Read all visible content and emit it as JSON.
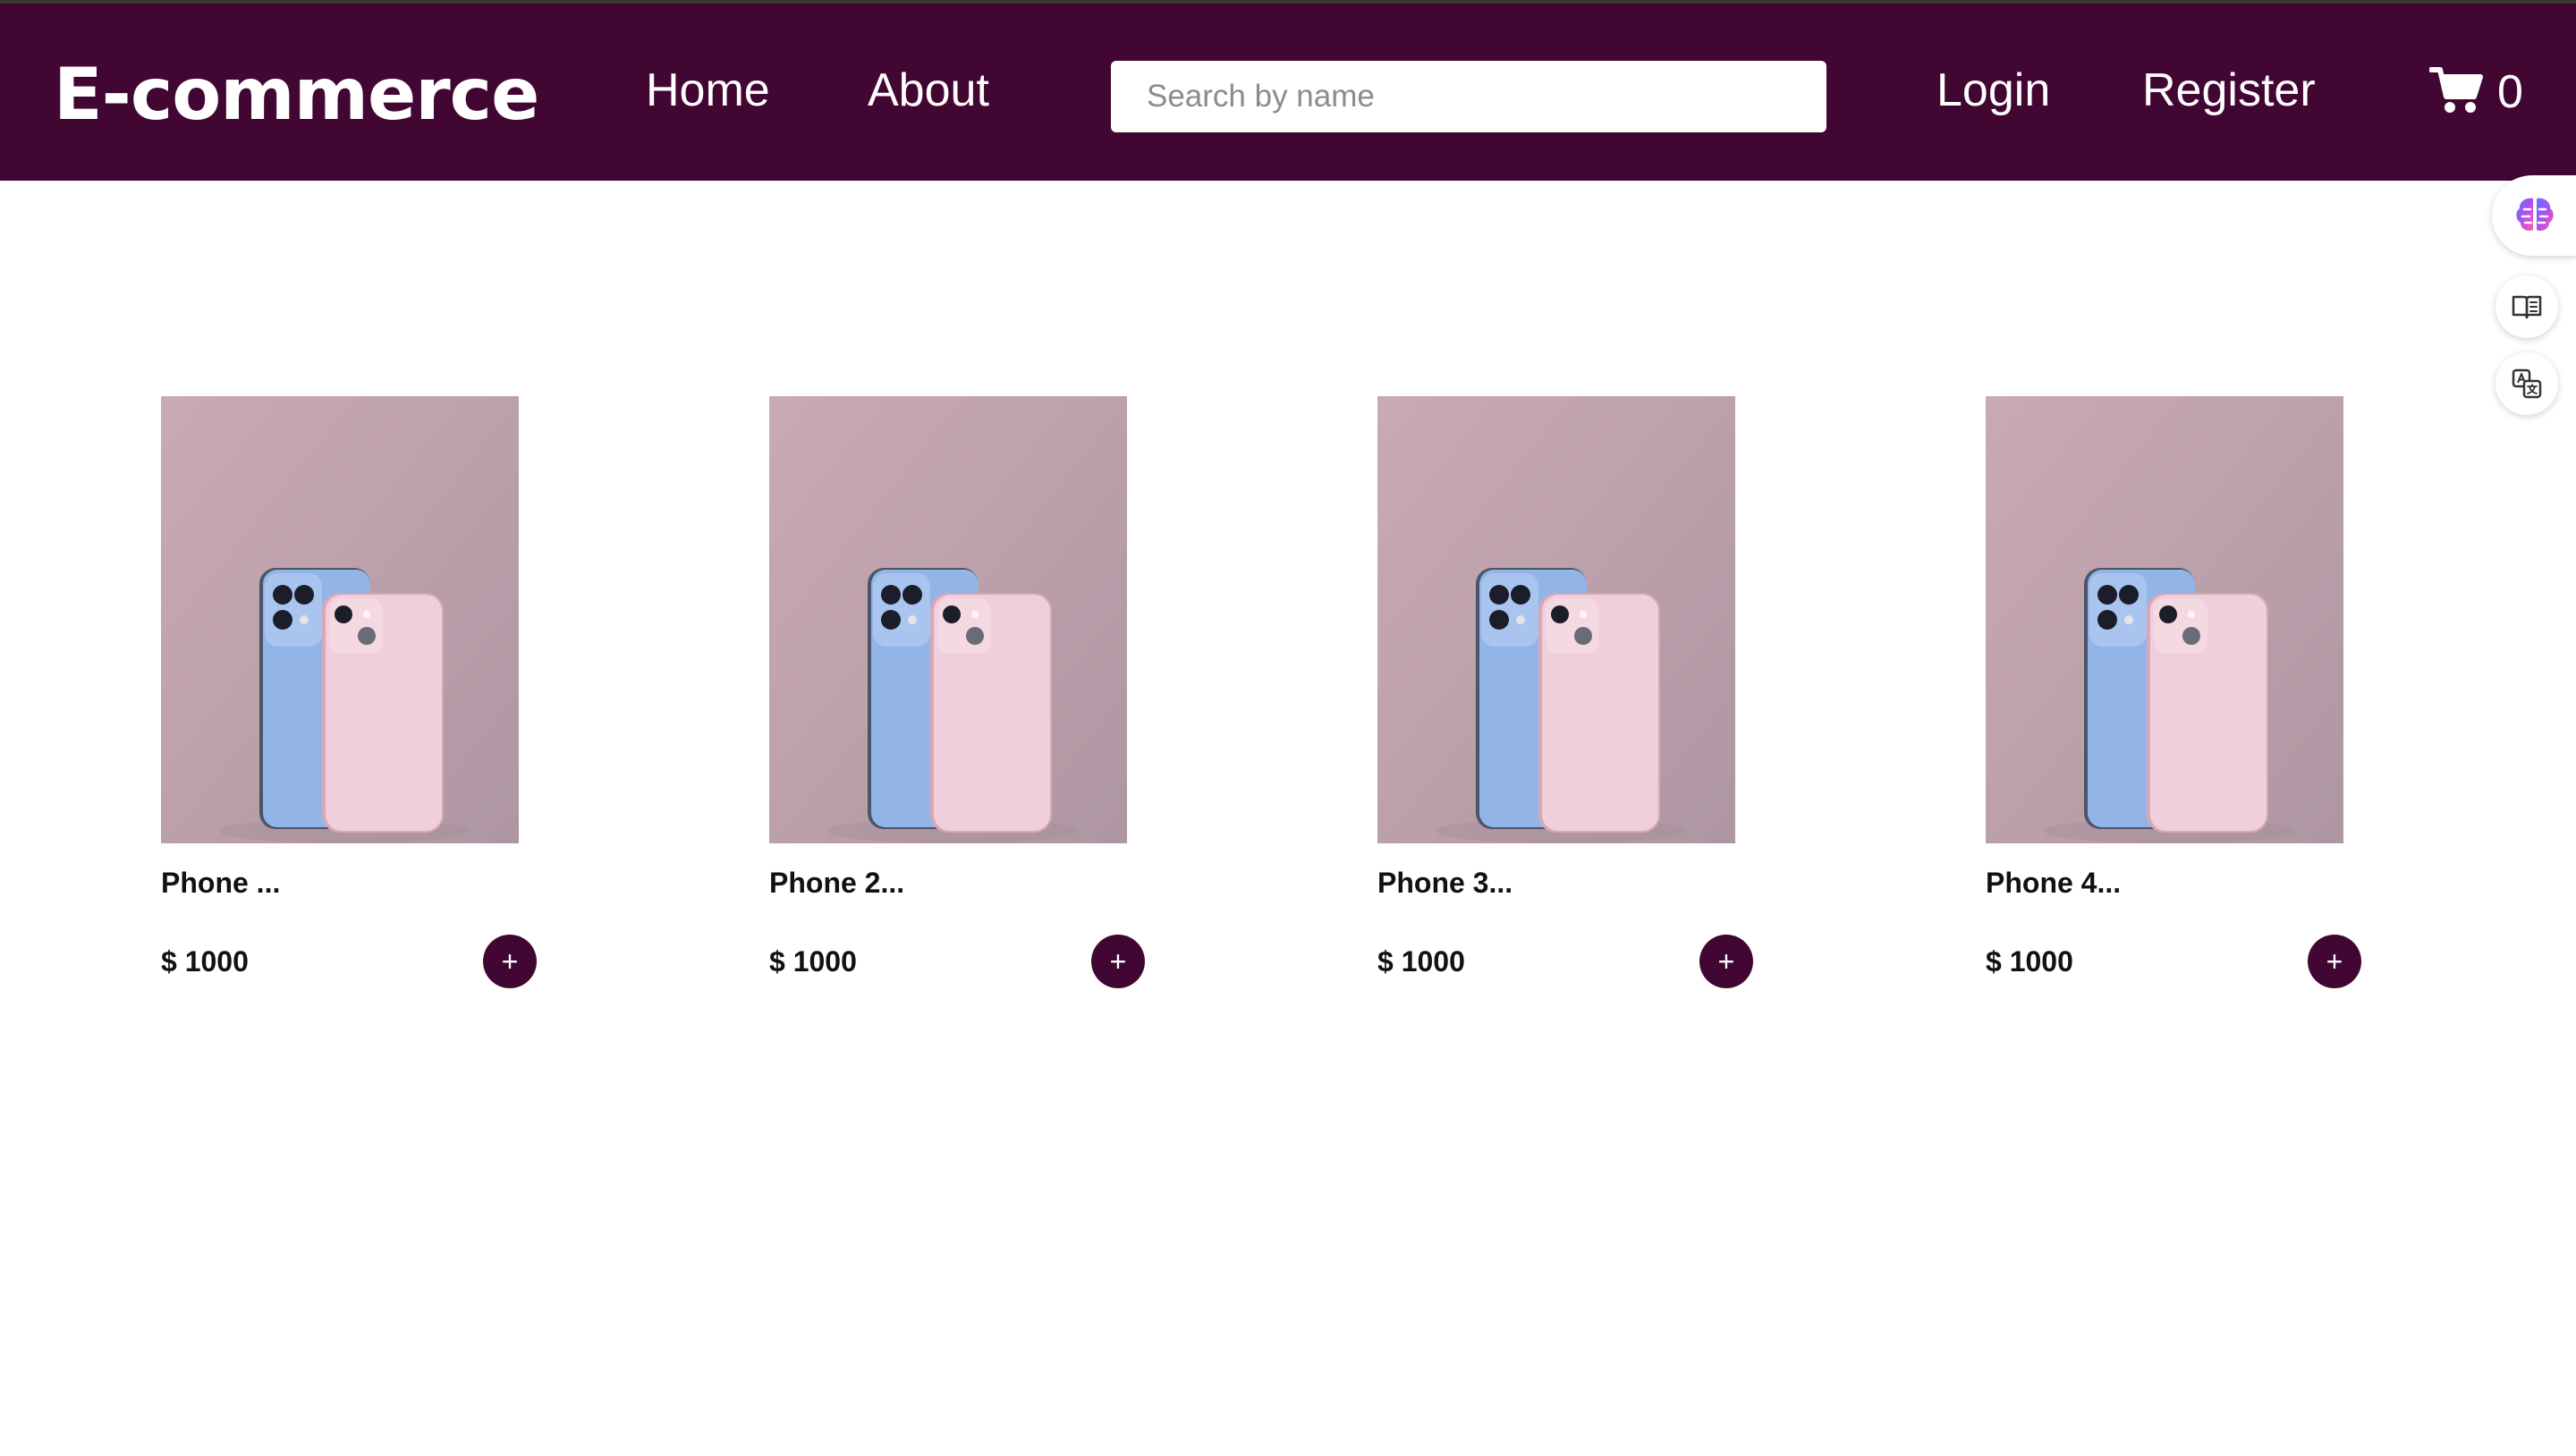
{
  "header": {
    "brand": "E-commerce",
    "nav": {
      "home": "Home",
      "about": "About",
      "login": "Login",
      "register": "Register"
    },
    "search": {
      "placeholder": "Search by name",
      "value": ""
    },
    "cart": {
      "icon": "cart-icon",
      "count": "0"
    }
  },
  "side_tools": [
    {
      "icon": "ai-brain-icon"
    },
    {
      "icon": "reader-icon"
    },
    {
      "icon": "translate-icon"
    }
  ],
  "products": [
    {
      "name": "Phone ...",
      "price": "$ 1000",
      "add_label": "+",
      "image": "phones-photo"
    },
    {
      "name": "Phone 2...",
      "price": "$ 1000",
      "add_label": "+",
      "image": "phones-photo"
    },
    {
      "name": "Phone 3...",
      "price": "$ 1000",
      "add_label": "+",
      "image": "phones-photo"
    },
    {
      "name": "Phone 4...",
      "price": "$ 1000",
      "add_label": "+",
      "image": "phones-photo"
    }
  ],
  "colors": {
    "brand": "#420633",
    "background": "#ffffff",
    "photo_background": "#c6a9b1",
    "phone_blue": "#8fb1e3",
    "phone_pink": "#eccad6"
  }
}
